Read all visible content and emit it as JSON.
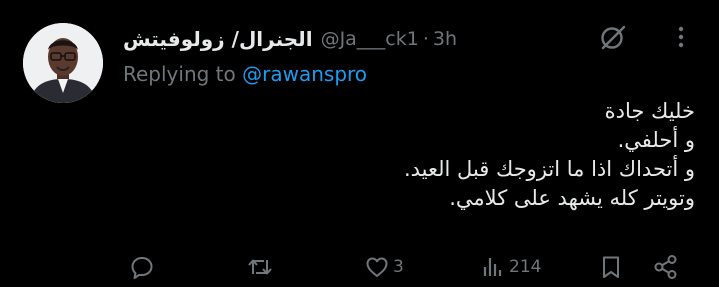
{
  "tweet": {
    "display_name": "الجنرال/ زولوفيتش",
    "handle": "@Ja___ck1",
    "separator": "·",
    "time": "3h",
    "replying_prefix": "Replying to",
    "replying_handle": "@rawanspro",
    "text_lines": [
      "خليك جادة",
      "و أحلفي.",
      "و أتحداك اذا ما اتزوجك قبل العيد.",
      "وتويتر كله يشهد على كلامي."
    ]
  },
  "actions": {
    "reply_count": "",
    "retweet_count": "",
    "like_count": "3",
    "views_count": "214"
  },
  "icons": {
    "grok": "grok-icon",
    "more": "more-icon",
    "reply": "reply-icon",
    "retweet": "retweet-icon",
    "like": "heart-icon",
    "views": "views-icon",
    "bookmark": "bookmark-icon",
    "share": "share-icon"
  },
  "colors": {
    "background": "#000000",
    "primary_text": "#e7e9ea",
    "secondary_text": "#71767b",
    "link": "#1d9bf0"
  }
}
